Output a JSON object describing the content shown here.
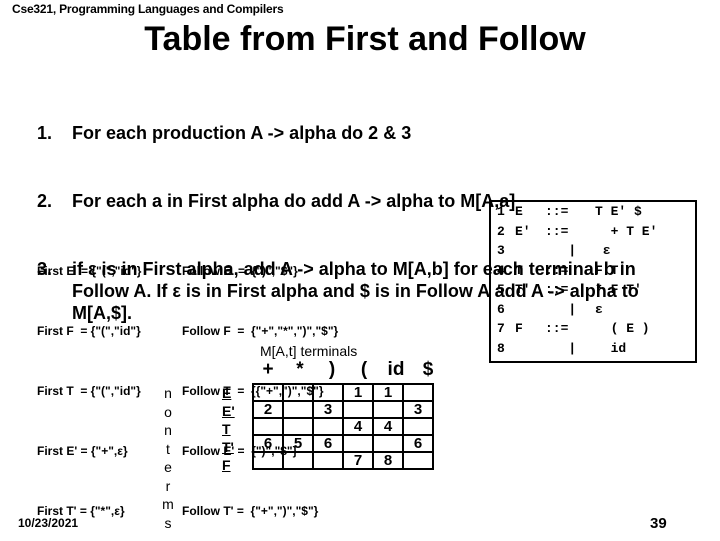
{
  "header": "Cse321, Programming Languages and Compilers",
  "title": "Table from First and Follow",
  "steps": [
    {
      "num": "1.",
      "text": "For each production A -> alpha do 2 & 3"
    },
    {
      "num": "2.",
      "text": "For each a in First alpha do add A -> alpha to  M[A,a]"
    },
    {
      "num": "3.",
      "text": "if ε is in First alpha, add A -> alpha to M[A,b] for each terminal b in Follow A. If ε is in First alpha  and $ is in Follow A add A -> alpha to M[A,$]."
    }
  ],
  "first_sets": [
    "First E  = {\"(\",\"id\"}",
    "First F  = {\"(\",\"id\"}",
    "First T  = {\"(\",\"id\"}",
    "First E' = {\"+\",ε}",
    "First T' = {\"*\",ε}"
  ],
  "follow_sets": [
    "Follow E  =  {\")\",\"$\"}",
    "Follow F  =  {\"+\",\"*\",\")\",\"$\"}",
    "Follow T  =  {{\"+\",\")\",\"$\"}",
    "Follow E' =  {\")\",\"$\"}",
    "Follow T' =  {\"+\",\")\",\"$\"}"
  ],
  "grammar": [
    {
      "num": "1",
      "lhs": "E",
      "op": "::=",
      "rhs": "T E' $"
    },
    {
      "num": "2",
      "lhs": "E'",
      "op": "::=",
      "rhs": "  + T E'"
    },
    {
      "num": "3",
      "lhs": "",
      "op": "   |",
      "rhs": " ε"
    },
    {
      "num": "4",
      "lhs": "T",
      "op": "::=",
      "rhs": "F T'"
    },
    {
      "num": "5",
      "lhs": "T'",
      "op": "::=",
      "rhs": "* F T'"
    },
    {
      "num": "6",
      "lhs": "",
      "op": "   |",
      "rhs": "ε"
    },
    {
      "num": "7",
      "lhs": "F",
      "op": "::=",
      "rhs": "  ( E )"
    },
    {
      "num": "8",
      "lhs": "",
      "op": "   |",
      "rhs": "  id"
    }
  ],
  "parse_table": {
    "title": "M[A,t] terminals",
    "terminals": [
      "+",
      "*",
      ")",
      "(",
      "id",
      "$"
    ],
    "nonterminals_label": [
      "n",
      "o",
      "n",
      "t",
      "e",
      "r",
      "m",
      "s"
    ],
    "nonterminals": [
      "E",
      "E'",
      "T",
      "T'",
      "F"
    ],
    "rows": [
      [
        "",
        "",
        "",
        "1",
        "1",
        ""
      ],
      [
        "2",
        "",
        "3",
        "",
        "",
        "3"
      ],
      [
        "",
        "",
        "",
        "4",
        "4",
        ""
      ],
      [
        "6",
        "5",
        "6",
        "",
        "",
        "6"
      ],
      [
        "",
        "",
        "",
        "7",
        "8",
        ""
      ]
    ]
  },
  "footer": {
    "date": "10/23/2021",
    "page": "39"
  }
}
